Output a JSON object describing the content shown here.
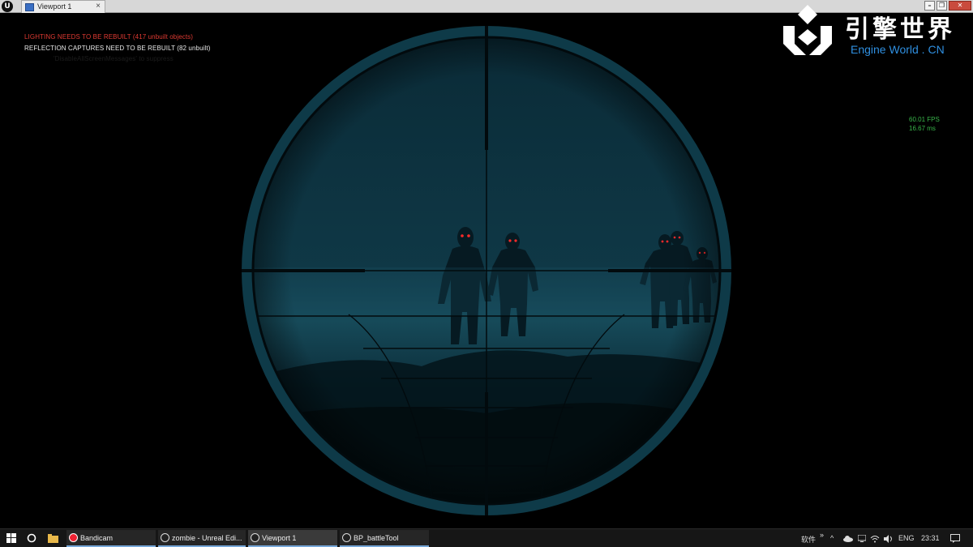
{
  "window": {
    "tab_title": "Viewport 1",
    "tab_close": "×",
    "buttons": {
      "minimize": "–",
      "restore": "❐",
      "close": "✕"
    }
  },
  "viewport": {
    "messages": {
      "lighting": "LIGHTING NEEDS TO BE REBUILT (417 unbuilt objects)",
      "reflection": "REFLECTION CAPTURES NEED TO BE REBUILT (82 unbuilt)",
      "faded": "'DisableAllScreenMessages' to suppress"
    },
    "stats": {
      "fps": "60.01 FPS",
      "ms": "16.67 ms"
    },
    "scene": {
      "description_icon": "sniper-scope-reticle",
      "colors": {
        "sky": "#0c2e3a",
        "fog": "#13414f",
        "ground": "#061820",
        "eyes": "#ff2a2a"
      }
    }
  },
  "watermark": {
    "chinese": "引擎世界",
    "english": "Engine World . CN"
  },
  "taskbar": {
    "apps": [
      {
        "label": "Bandicam",
        "icon": "bandicam-record-icon"
      },
      {
        "label": "zombie - Unreal Edi...",
        "icon": "unreal-icon"
      },
      {
        "label": "Viewport 1",
        "icon": "unreal-icon"
      },
      {
        "label": "BP_battleTool",
        "icon": "unreal-icon"
      }
    ],
    "tray": {
      "ime": "软件",
      "chevron": "»",
      "language": "ENG",
      "time": "23:31"
    }
  }
}
